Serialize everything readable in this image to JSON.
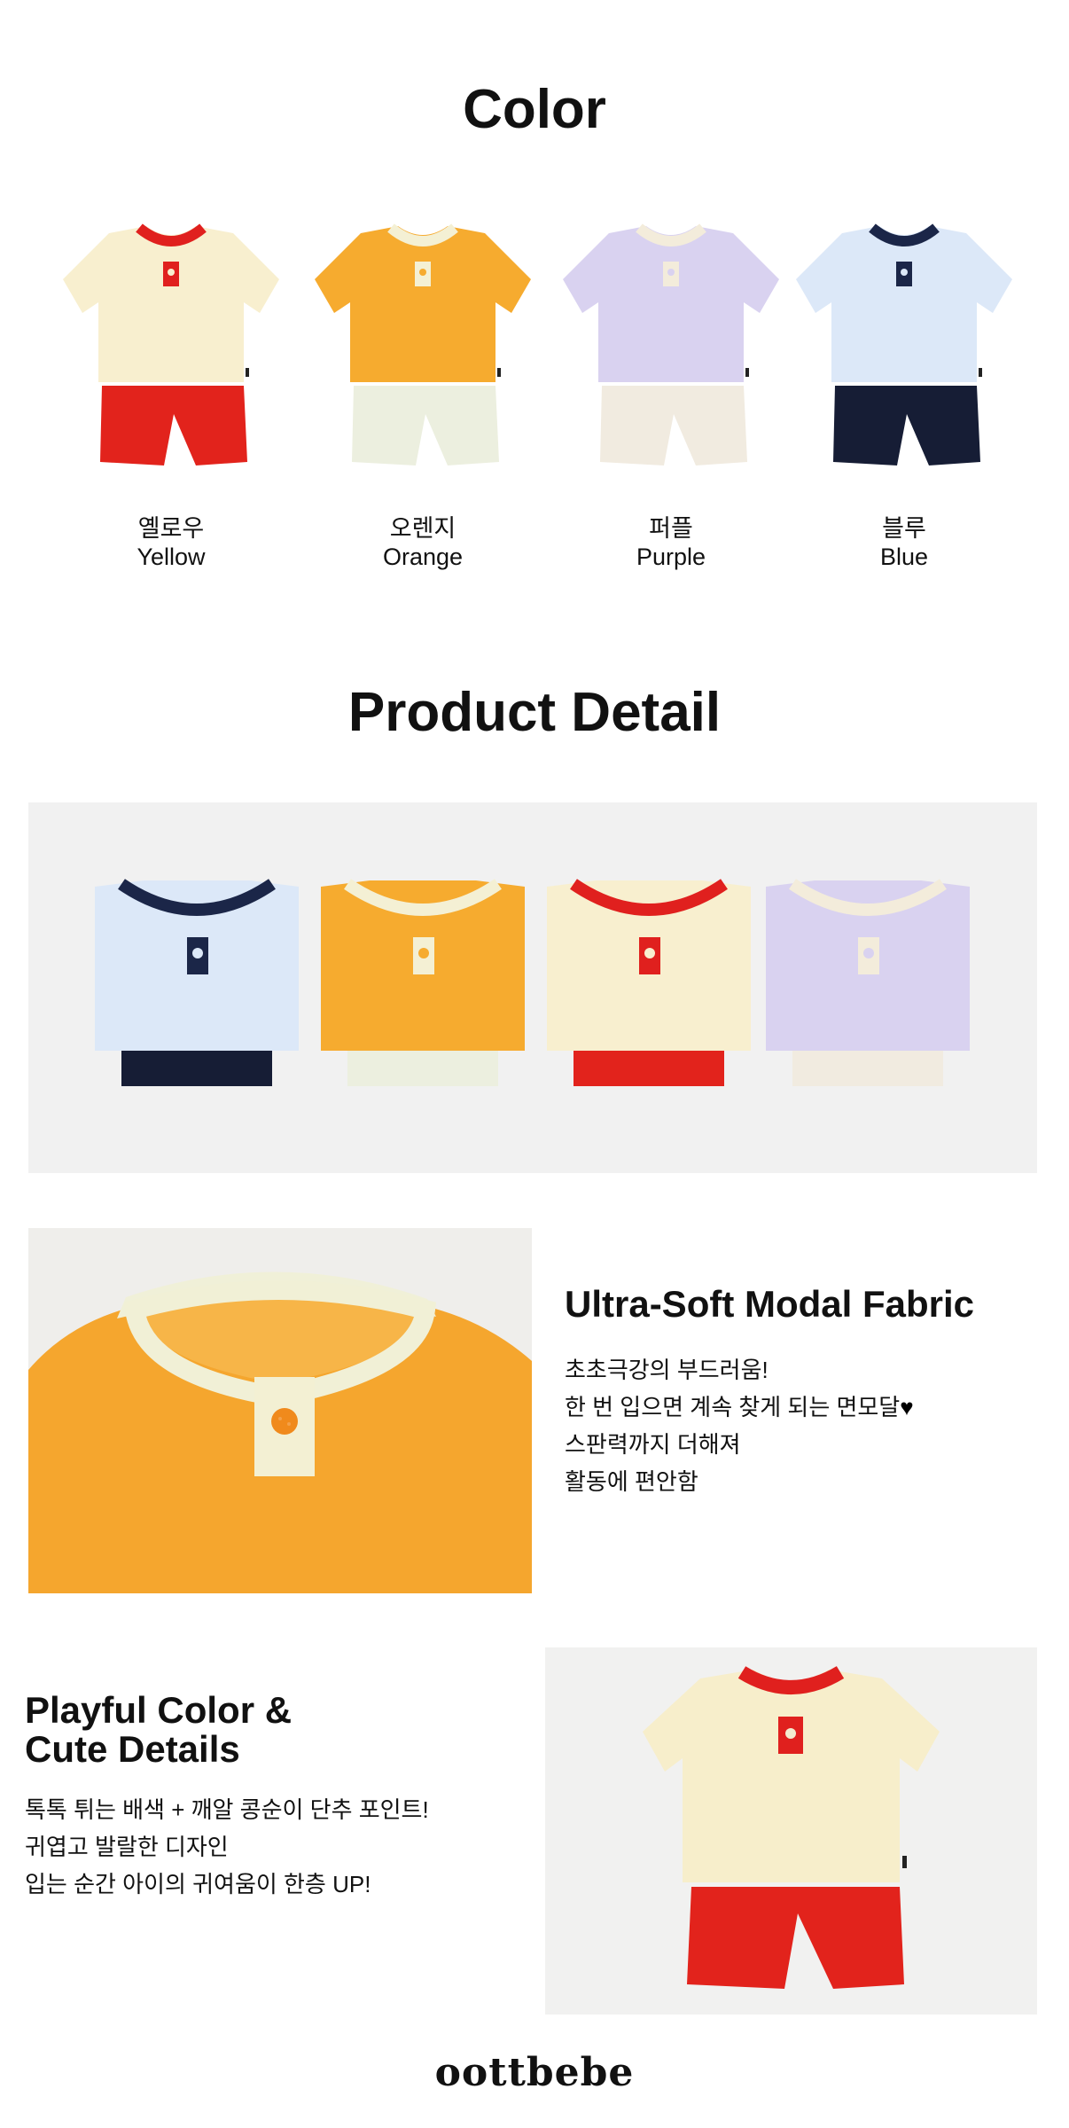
{
  "color_section": {
    "title": "Color",
    "swatches": [
      {
        "ko": "옐로우",
        "en": "Yellow",
        "shirt": "#f8efcf",
        "trim": "#e0201e",
        "pants": "#e2231c"
      },
      {
        "ko": "오렌지",
        "en": "Orange",
        "shirt": "#f6ab2f",
        "trim": "#f4f0d4",
        "pants": "#ecefdf"
      },
      {
        "ko": "퍼플",
        "en": "Purple",
        "shirt": "#d9d2f0",
        "trim": "#f3ecdb",
        "pants": "#f1ebe0"
      },
      {
        "ko": "블루",
        "en": "Blue",
        "shirt": "#dce8f8",
        "trim": "#1b2648",
        "pants": "#161d35"
      }
    ]
  },
  "detail_section": {
    "title": "Product Detail"
  },
  "feature_1": {
    "title": "Ultra-Soft Modal Fabric",
    "lines": [
      "초초극강의 부드러움!",
      "한 번 입으면 계속 찾게 되는 면모달",
      "스판력까지 더해져",
      "활동에 편안함"
    ],
    "heart": "♥"
  },
  "feature_2": {
    "title_line1": "Playful Color &",
    "title_line2": "Cute Details",
    "lines": [
      "톡톡 튀는 배색 + 깨알 콩순이 단추 포인트!",
      "귀엽고 발랄한 디자인",
      "입는 순간 아이의 귀여움이 한층 UP!"
    ]
  },
  "brand": "oottbebe",
  "icons": {
    "swatch_image": "tshirt-set-icon",
    "folded_image": "folded-sets-image",
    "closeup_image": "collar-closeup-image",
    "flatlay_image": "yellow-set-image"
  }
}
